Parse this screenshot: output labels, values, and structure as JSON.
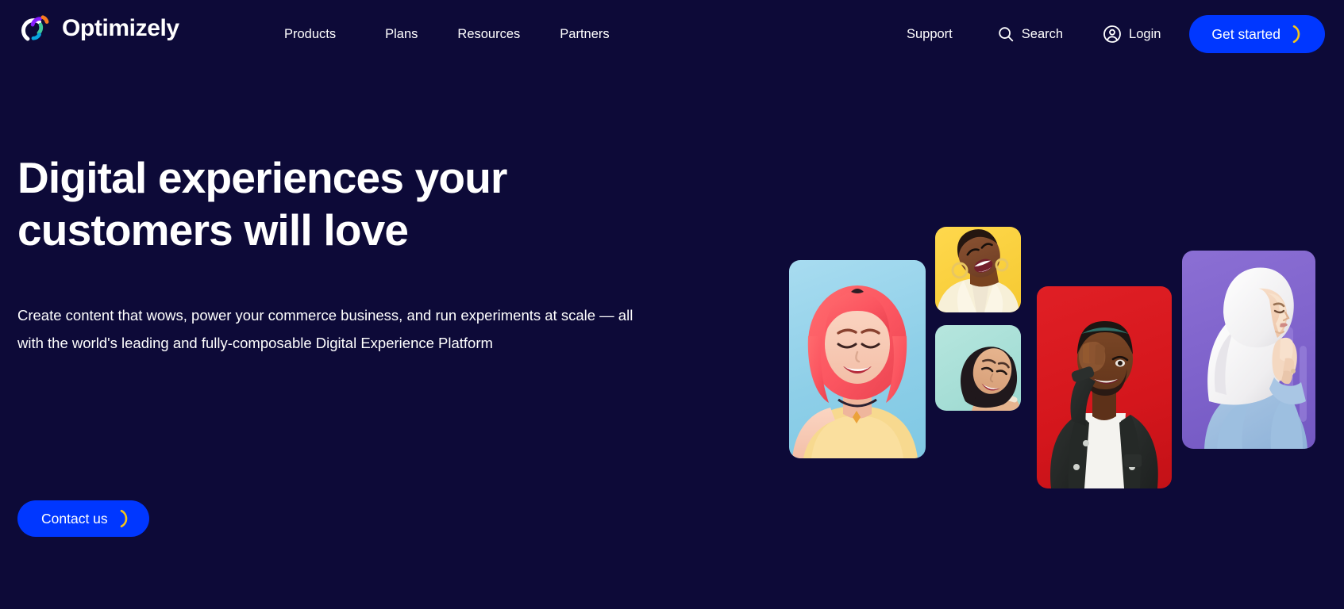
{
  "brand": {
    "name": "Optimizely",
    "logo_icon": "optimizely-logo-icon",
    "logo_colors": {
      "white": "#ffffff",
      "purple": "#861dff",
      "green": "#3fc79a",
      "cyan": "#08a6e0",
      "orange": "#f87b1f"
    }
  },
  "nav": {
    "items": [
      {
        "label": "Products"
      },
      {
        "label": "Plans"
      },
      {
        "label": "Resources"
      },
      {
        "label": "Partners"
      }
    ]
  },
  "utility": {
    "support_label": "Support",
    "search_label": "Search",
    "search_icon": "search-icon",
    "login_label": "Login",
    "login_icon": "user-circle-icon",
    "get_started_label": "Get started",
    "get_started_icon": "crescent-arc-icon"
  },
  "hero": {
    "title": "Digital experiences your customers will love",
    "subtitle": "Create content that wows, power your commerce business, and run experiments at scale — all with the world's leading and fully-composable Digital Experience Platform",
    "cta_label": "Contact us",
    "cta_icon": "crescent-arc-icon"
  },
  "colors": {
    "background": "#0d0a38",
    "accent_blue": "#0037ff",
    "crescent_yellow": "#f5c518",
    "text": "#ffffff"
  },
  "collage": {
    "cards": [
      {
        "name": "portrait-pink-hair-woman",
        "backdrop": "#8ecfe8",
        "backdrop_name": "light-blue"
      },
      {
        "name": "portrait-laughing-woman",
        "backdrop": "#f9cf3c",
        "backdrop_name": "yellow"
      },
      {
        "name": "portrait-smiling-woman",
        "backdrop": "#a6ded6",
        "backdrop_name": "mint"
      },
      {
        "name": "portrait-man-hand-on-face",
        "backdrop": "#d4161c",
        "backdrop_name": "red"
      },
      {
        "name": "portrait-woman-hijab",
        "backdrop": "#7e62cb",
        "backdrop_name": "purple"
      }
    ]
  }
}
